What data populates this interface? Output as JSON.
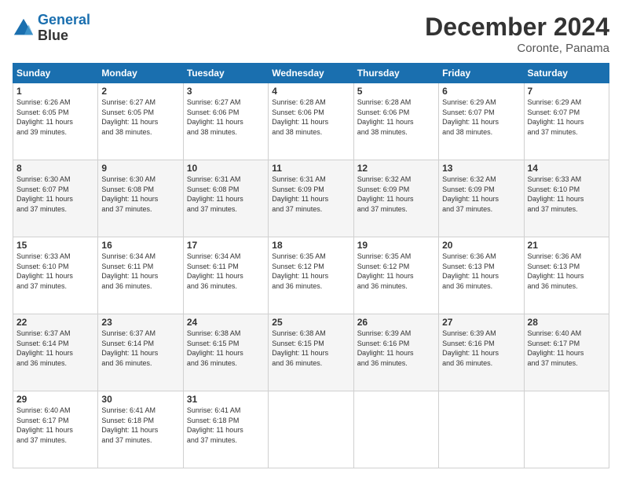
{
  "header": {
    "logo_line1": "General",
    "logo_line2": "Blue",
    "month": "December 2024",
    "location": "Coronte, Panama"
  },
  "weekdays": [
    "Sunday",
    "Monday",
    "Tuesday",
    "Wednesday",
    "Thursday",
    "Friday",
    "Saturday"
  ],
  "weeks": [
    [
      {
        "day": "1",
        "sunrise": "6:26 AM",
        "sunset": "6:05 PM",
        "daylight": "11 hours and 39 minutes."
      },
      {
        "day": "2",
        "sunrise": "6:27 AM",
        "sunset": "6:05 PM",
        "daylight": "11 hours and 38 minutes."
      },
      {
        "day": "3",
        "sunrise": "6:27 AM",
        "sunset": "6:06 PM",
        "daylight": "11 hours and 38 minutes."
      },
      {
        "day": "4",
        "sunrise": "6:28 AM",
        "sunset": "6:06 PM",
        "daylight": "11 hours and 38 minutes."
      },
      {
        "day": "5",
        "sunrise": "6:28 AM",
        "sunset": "6:06 PM",
        "daylight": "11 hours and 38 minutes."
      },
      {
        "day": "6",
        "sunrise": "6:29 AM",
        "sunset": "6:07 PM",
        "daylight": "11 hours and 38 minutes."
      },
      {
        "day": "7",
        "sunrise": "6:29 AM",
        "sunset": "6:07 PM",
        "daylight": "11 hours and 37 minutes."
      }
    ],
    [
      {
        "day": "8",
        "sunrise": "6:30 AM",
        "sunset": "6:07 PM",
        "daylight": "11 hours and 37 minutes."
      },
      {
        "day": "9",
        "sunrise": "6:30 AM",
        "sunset": "6:08 PM",
        "daylight": "11 hours and 37 minutes."
      },
      {
        "day": "10",
        "sunrise": "6:31 AM",
        "sunset": "6:08 PM",
        "daylight": "11 hours and 37 minutes."
      },
      {
        "day": "11",
        "sunrise": "6:31 AM",
        "sunset": "6:09 PM",
        "daylight": "11 hours and 37 minutes."
      },
      {
        "day": "12",
        "sunrise": "6:32 AM",
        "sunset": "6:09 PM",
        "daylight": "11 hours and 37 minutes."
      },
      {
        "day": "13",
        "sunrise": "6:32 AM",
        "sunset": "6:09 PM",
        "daylight": "11 hours and 37 minutes."
      },
      {
        "day": "14",
        "sunrise": "6:33 AM",
        "sunset": "6:10 PM",
        "daylight": "11 hours and 37 minutes."
      }
    ],
    [
      {
        "day": "15",
        "sunrise": "6:33 AM",
        "sunset": "6:10 PM",
        "daylight": "11 hours and 37 minutes."
      },
      {
        "day": "16",
        "sunrise": "6:34 AM",
        "sunset": "6:11 PM",
        "daylight": "11 hours and 36 minutes."
      },
      {
        "day": "17",
        "sunrise": "6:34 AM",
        "sunset": "6:11 PM",
        "daylight": "11 hours and 36 minutes."
      },
      {
        "day": "18",
        "sunrise": "6:35 AM",
        "sunset": "6:12 PM",
        "daylight": "11 hours and 36 minutes."
      },
      {
        "day": "19",
        "sunrise": "6:35 AM",
        "sunset": "6:12 PM",
        "daylight": "11 hours and 36 minutes."
      },
      {
        "day": "20",
        "sunrise": "6:36 AM",
        "sunset": "6:13 PM",
        "daylight": "11 hours and 36 minutes."
      },
      {
        "day": "21",
        "sunrise": "6:36 AM",
        "sunset": "6:13 PM",
        "daylight": "11 hours and 36 minutes."
      }
    ],
    [
      {
        "day": "22",
        "sunrise": "6:37 AM",
        "sunset": "6:14 PM",
        "daylight": "11 hours and 36 minutes."
      },
      {
        "day": "23",
        "sunrise": "6:37 AM",
        "sunset": "6:14 PM",
        "daylight": "11 hours and 36 minutes."
      },
      {
        "day": "24",
        "sunrise": "6:38 AM",
        "sunset": "6:15 PM",
        "daylight": "11 hours and 36 minutes."
      },
      {
        "day": "25",
        "sunrise": "6:38 AM",
        "sunset": "6:15 PM",
        "daylight": "11 hours and 36 minutes."
      },
      {
        "day": "26",
        "sunrise": "6:39 AM",
        "sunset": "6:16 PM",
        "daylight": "11 hours and 36 minutes."
      },
      {
        "day": "27",
        "sunrise": "6:39 AM",
        "sunset": "6:16 PM",
        "daylight": "11 hours and 36 minutes."
      },
      {
        "day": "28",
        "sunrise": "6:40 AM",
        "sunset": "6:17 PM",
        "daylight": "11 hours and 37 minutes."
      }
    ],
    [
      {
        "day": "29",
        "sunrise": "6:40 AM",
        "sunset": "6:17 PM",
        "daylight": "11 hours and 37 minutes."
      },
      {
        "day": "30",
        "sunrise": "6:41 AM",
        "sunset": "6:18 PM",
        "daylight": "11 hours and 37 minutes."
      },
      {
        "day": "31",
        "sunrise": "6:41 AM",
        "sunset": "6:18 PM",
        "daylight": "11 hours and 37 minutes."
      },
      null,
      null,
      null,
      null
    ]
  ]
}
